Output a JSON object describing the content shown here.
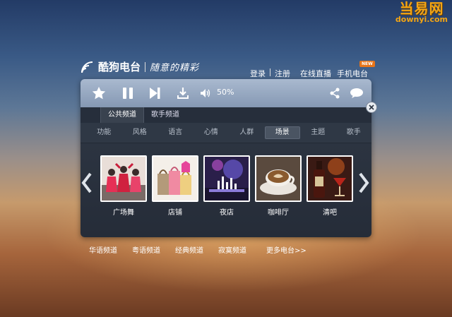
{
  "watermark": {
    "brand": "当易网",
    "domain": "downyi.com"
  },
  "header": {
    "brand_name": "酷狗电台",
    "slogan": "随意的精彩",
    "links": [
      "登录",
      "注册",
      "在线直播",
      "手机电台"
    ],
    "new_badge": "NEW"
  },
  "player": {
    "volume": "50%",
    "volume_level": 0.5
  },
  "tabs": {
    "items": [
      "公共频道",
      "歌手频道"
    ],
    "active": "公共频道"
  },
  "categories": {
    "items": [
      "功能",
      "风格",
      "语言",
      "心情",
      "人群",
      "场景",
      "主题",
      "歌手"
    ],
    "active": "场景"
  },
  "channels": [
    {
      "label": "广场舞"
    },
    {
      "label": "店铺"
    },
    {
      "label": "夜店"
    },
    {
      "label": "咖啡厅"
    },
    {
      "label": "清吧"
    }
  ],
  "bottom_links": [
    "华语频道",
    "粤语频道",
    "经典频道",
    "寂寞频道",
    "更多电台>>"
  ],
  "colors": {
    "accent_orange": "#e8751a",
    "watermark_orange": "#f3a514",
    "toolbar": "#96a7c0",
    "panel_dark": "#2c3441"
  }
}
